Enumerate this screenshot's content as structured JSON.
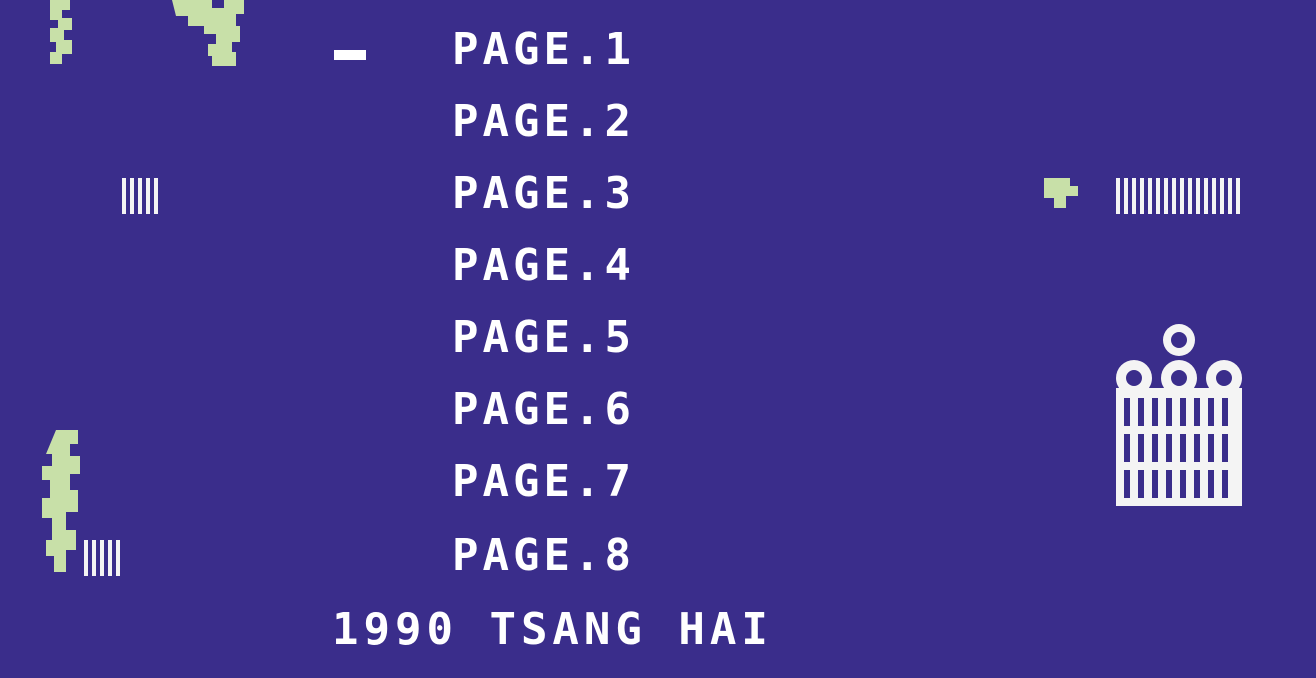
{
  "colors": {
    "background": "#3a2d8b",
    "brick": "#f4bcbc",
    "text": "#ffffff",
    "vine": "#c8e0a8",
    "bars": "#f4f4f4"
  },
  "menu": {
    "selected_index": 0,
    "items": [
      "PAGE.1",
      "PAGE.2",
      "PAGE.3",
      "PAGE.4",
      "PAGE.5",
      "PAGE.6",
      "PAGE.7",
      "PAGE.8"
    ]
  },
  "credit": "1990 TSANG HAI",
  "icons": {
    "cursor": "selection-cursor-icon",
    "vine": "vine-icon",
    "cage": "birdcage-icon",
    "bars": "window-bars-icon"
  }
}
